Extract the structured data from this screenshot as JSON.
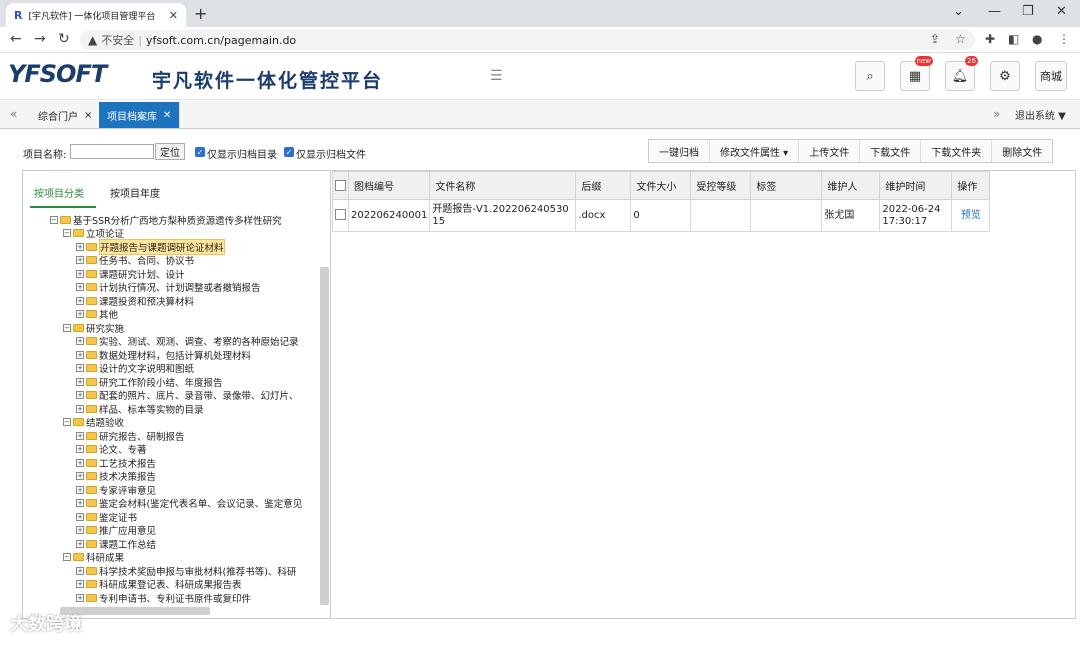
{
  "browser": {
    "tab_title": "[宇凡软件] 一体化项目管理平台",
    "new_tab": "+",
    "url_warning": "不安全",
    "url": "yfsoft.com.cn/pagemain.do"
  },
  "header": {
    "logo": "YFSOFT",
    "app_title": "宇凡软件一体化管控平台",
    "badges": {
      "apps": "new",
      "bell": "26"
    },
    "shop_label": "商城"
  },
  "page_tabs": [
    {
      "label": "综合门户"
    },
    {
      "label": "项目档案库"
    }
  ],
  "logout_label": "退出系统",
  "toolbar": {
    "project_name_label": "项目名称:",
    "locate_label": "定位",
    "only_archive_dirs": "仅显示归档目录",
    "only_archive_files": "仅显示归档文件",
    "actions": [
      "一键归档",
      "修改文件属性 ▾",
      "上传文件",
      "下载文件",
      "下载文件夹",
      "删除文件"
    ]
  },
  "left_tabs": [
    "按项目分类",
    "按项目年度"
  ],
  "tree": [
    {
      "level": 0,
      "pm": "⊟",
      "label": "基于SSR分析广西地方梨种质资源遗传多样性研究"
    },
    {
      "level": 1,
      "pm": "⊟",
      "label": "立项论证"
    },
    {
      "level": 2,
      "pm": "⊞",
      "label": "开题报告与课题调研论证材料",
      "selected": true
    },
    {
      "level": 2,
      "pm": "⊞",
      "label": "任务书、合同、协议书"
    },
    {
      "level": 2,
      "pm": "⊞",
      "label": "课题研究计划、设计"
    },
    {
      "level": 2,
      "pm": "⊞",
      "label": "计划执行情况、计划调整或者撤销报告"
    },
    {
      "level": 2,
      "pm": "⊞",
      "label": "课题投资和预决算材料"
    },
    {
      "level": 2,
      "pm": "⊞",
      "label": "其他"
    },
    {
      "level": 1,
      "pm": "⊟",
      "label": "研究实施"
    },
    {
      "level": 2,
      "pm": "⊞",
      "label": "实验、测试、观测、调查、考察的各种原始记录"
    },
    {
      "level": 2,
      "pm": "⊞",
      "label": "数据处理材料，包括计算机处理材料"
    },
    {
      "level": 2,
      "pm": "⊞",
      "label": "设计的文字说明和图纸"
    },
    {
      "level": 2,
      "pm": "⊞",
      "label": "研究工作阶段小结、年度报告"
    },
    {
      "level": 2,
      "pm": "⊞",
      "label": "配套的照片、底片、录音带、录像带、幻灯片、"
    },
    {
      "level": 2,
      "pm": "⊞",
      "label": "样品、标本等实物的目录"
    },
    {
      "level": 1,
      "pm": "⊟",
      "label": "结题验收"
    },
    {
      "level": 2,
      "pm": "⊞",
      "label": "研究报告、研制报告"
    },
    {
      "level": 2,
      "pm": "⊞",
      "label": "论文、专著"
    },
    {
      "level": 2,
      "pm": "⊞",
      "label": "工艺技术报告"
    },
    {
      "level": 2,
      "pm": "⊞",
      "label": "技术决策报告"
    },
    {
      "level": 2,
      "pm": "⊞",
      "label": "专家评审意见"
    },
    {
      "level": 2,
      "pm": "⊞",
      "label": "鉴定会材料(鉴定代表名单、会议记录、鉴定意见"
    },
    {
      "level": 2,
      "pm": "⊞",
      "label": "鉴定证书"
    },
    {
      "level": 2,
      "pm": "⊞",
      "label": "推广应用意见"
    },
    {
      "level": 2,
      "pm": "⊞",
      "label": "课题工作总结"
    },
    {
      "level": 1,
      "pm": "⊟",
      "label": "科研成果"
    },
    {
      "level": 2,
      "pm": "⊞",
      "label": "科学技术奖励申报与审批材料(推荐书等)、科研"
    },
    {
      "level": 2,
      "pm": "⊞",
      "label": "科研成果登记表、科研成果报告表"
    },
    {
      "level": 2,
      "pm": "⊞",
      "label": "专利申请书、专利证书原件或复印件"
    }
  ],
  "grid": {
    "columns": [
      "图档编号",
      "文件名称",
      "后缀",
      "文件大小",
      "受控等级",
      "标签",
      "维护人",
      "维护时间",
      "操作"
    ],
    "rows": [
      {
        "id": "202206240001",
        "name": "开题报告-V1.20220624053015",
        "ext": ".docx",
        "size": "0",
        "level": "",
        "tag": "",
        "maintainer": "张尤国",
        "time": "2022-06-24 17:30:17",
        "action": "预览"
      }
    ]
  },
  "watermark": "大数跨境"
}
